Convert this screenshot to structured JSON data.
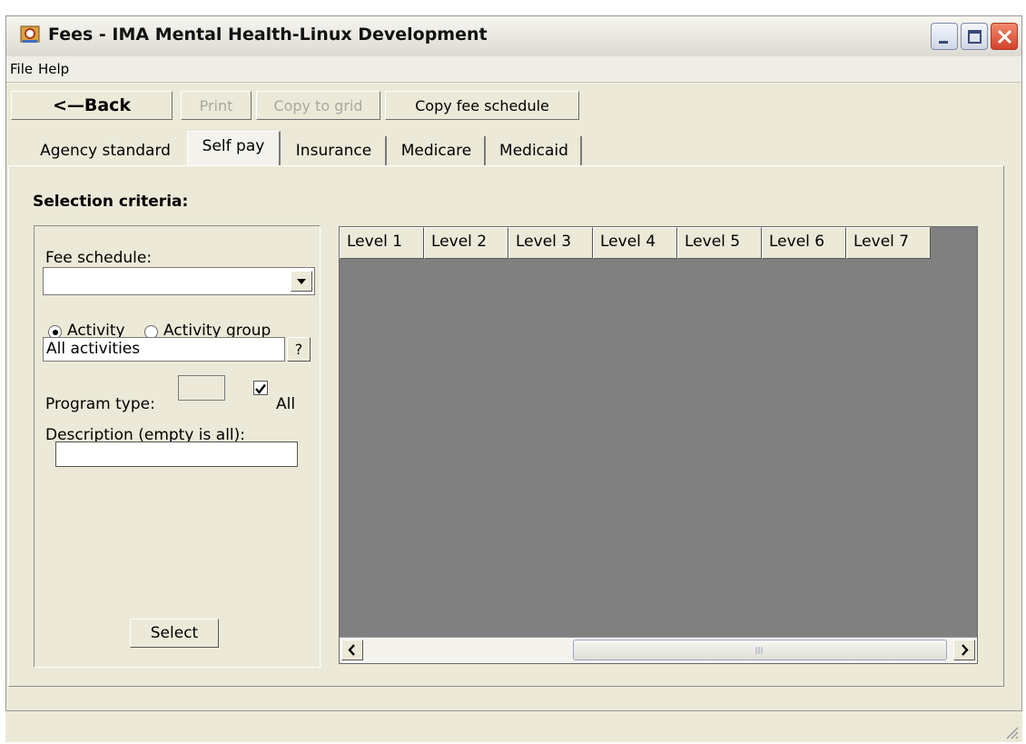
{
  "window": {
    "title": "Fees - IMA Mental Health-Linux Development",
    "controls": [
      "minimize-icon",
      "maximize-icon",
      "close-icon"
    ]
  },
  "menu": [
    "File",
    "Help"
  ],
  "toolbar": {
    "back_label": "<—Back",
    "print_label": "Print",
    "copy_to_grid_label": "Copy to grid",
    "copy_fee_schedule_label": "Copy fee schedule"
  },
  "tabs": [
    {
      "label": "Agency standard",
      "selected": false
    },
    {
      "label": "Self pay",
      "selected": true
    },
    {
      "label": "Insurance",
      "selected": false
    },
    {
      "label": "Medicare",
      "selected": false
    },
    {
      "label": "Medicaid",
      "selected": false
    }
  ],
  "criteria": {
    "title": "Selection criteria:",
    "fee_schedule_label": "Fee schedule:",
    "fee_schedule_value": "",
    "radio_activity_label": "Activity",
    "radio_activity_group_label": "Activity group",
    "selected_radio": "Activity",
    "activity_value": "All activities",
    "lookup_label": "?",
    "program_type_label": "Program type:",
    "program_type_value": "",
    "all_label": "All",
    "all_checked": true,
    "description_label": "Description (empty is all):",
    "description_value": "",
    "select_label": "Select"
  },
  "grid": {
    "columns": [
      "Level 1",
      "Level 2",
      "Level 3",
      "Level 4",
      "Level 5",
      "Level 6",
      "Level 7"
    ],
    "rows": []
  },
  "colors": {
    "window_bg": "#ece9d8",
    "grid_bg": "#808080",
    "close_button": "#d5412a"
  }
}
